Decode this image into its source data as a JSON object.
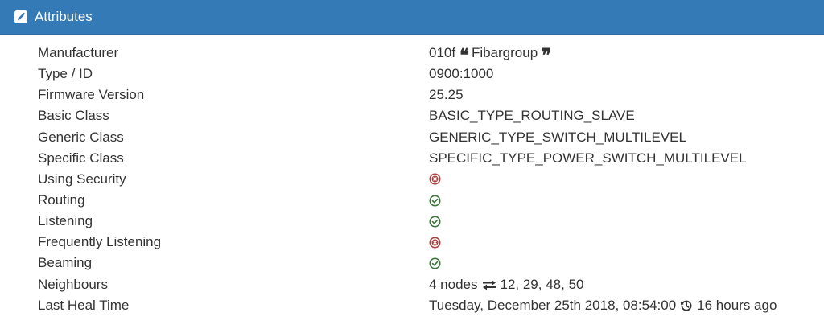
{
  "header": {
    "title": "Attributes",
    "icon": "pencil-square-icon",
    "background": "#337ab7"
  },
  "attributes": {
    "manufacturer": {
      "label": "Manufacturer",
      "id": "010f",
      "name": "Fibargroup"
    },
    "type_id": {
      "label": "Type / ID",
      "value": "0900:1000"
    },
    "firmware": {
      "label": "Firmware Version",
      "value": "25.25"
    },
    "basic_class": {
      "label": "Basic Class",
      "value": "BASIC_TYPE_ROUTING_SLAVE"
    },
    "generic_class": {
      "label": "Generic Class",
      "value": "GENERIC_TYPE_SWITCH_MULTILEVEL"
    },
    "specific_class": {
      "label": "Specific Class",
      "value": "SPECIFIC_TYPE_POWER_SWITCH_MULTILEVEL"
    },
    "using_security": {
      "label": "Using Security",
      "value": false,
      "icon": "x-circle-icon",
      "color": "#a94442"
    },
    "routing": {
      "label": "Routing",
      "value": true,
      "icon": "check-circle-icon",
      "color": "#3c763d"
    },
    "listening": {
      "label": "Listening",
      "value": true,
      "icon": "check-circle-icon",
      "color": "#3c763d"
    },
    "frequently_listening": {
      "label": "Frequently Listening",
      "value": false,
      "icon": "x-circle-icon",
      "color": "#a94442"
    },
    "beaming": {
      "label": "Beaming",
      "value": true,
      "icon": "check-circle-icon",
      "color": "#3c763d"
    },
    "neighbours": {
      "label": "Neighbours",
      "count": "4 nodes",
      "list": "12, 29, 48, 50",
      "icon": "exchange-arrows-icon"
    },
    "last_heal": {
      "label": "Last Heal Time",
      "date": "Tuesday, December 25th 2018, 08:54:00",
      "relative": "16 hours ago",
      "icon": "history-icon"
    }
  }
}
